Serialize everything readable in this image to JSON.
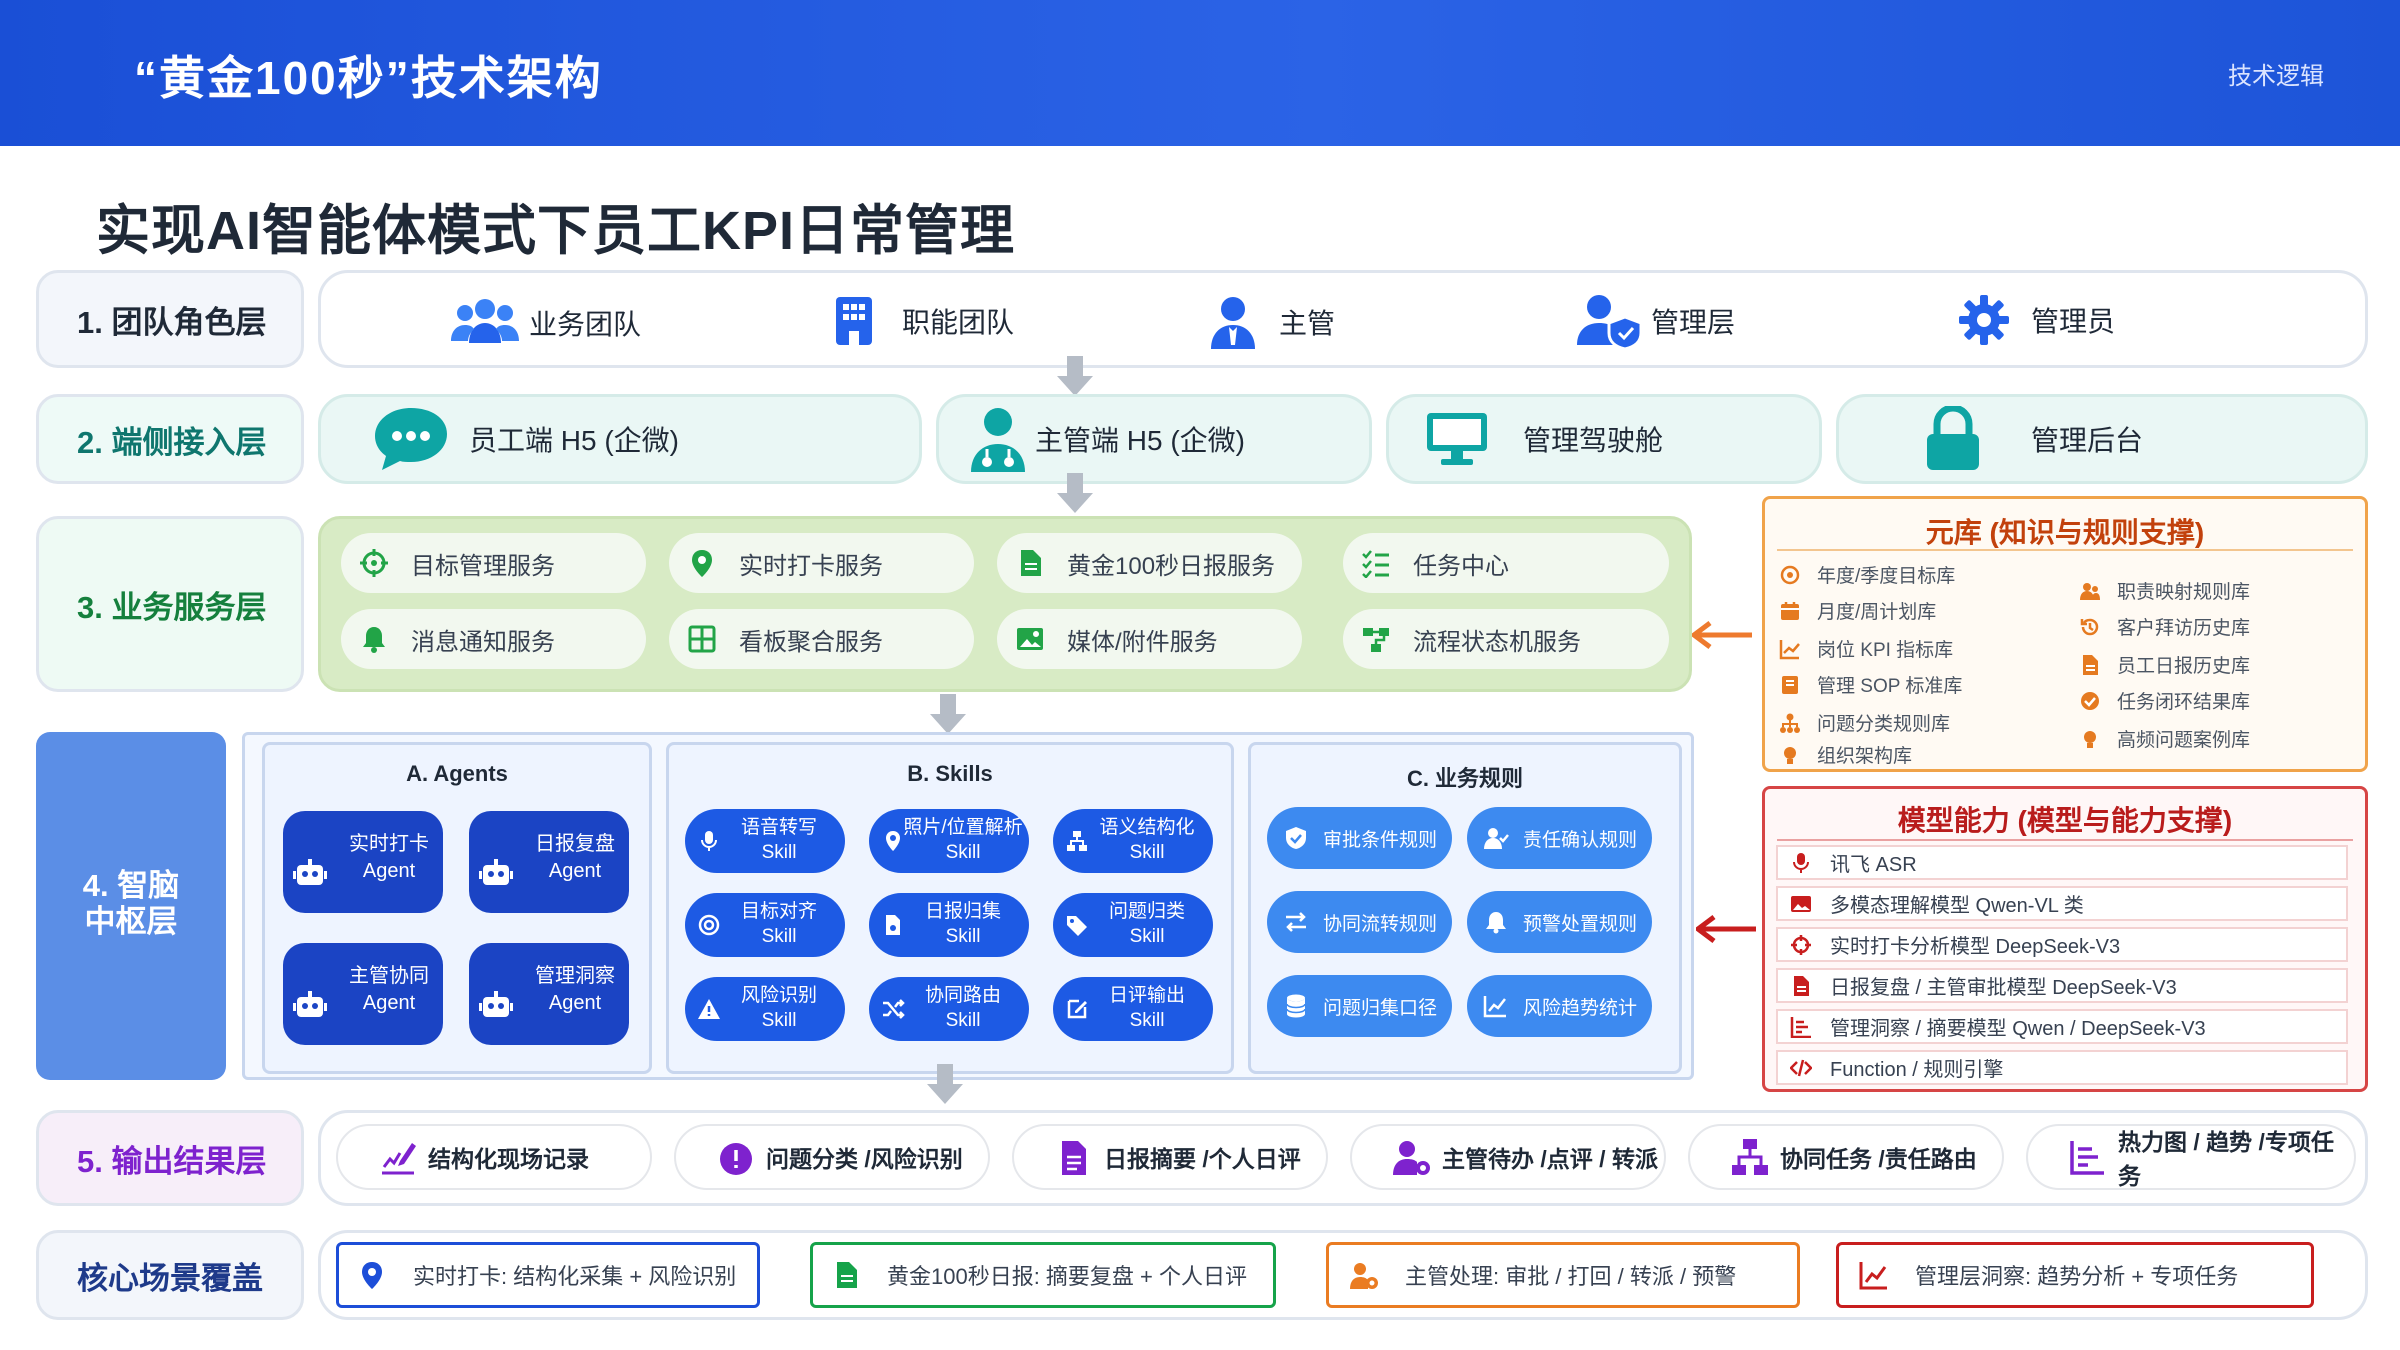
{
  "header": {
    "title": "“黄金100秒”技术架构",
    "tag": "技术逻辑"
  },
  "page_title": "实现AI智能体模式下员工KPI日常管理",
  "layer1": {
    "label": "1. 团队角色层",
    "roles": [
      {
        "label": "业务团队",
        "icon": "team-icon"
      },
      {
        "label": "职能团队",
        "icon": "building-icon"
      },
      {
        "label": "主管",
        "icon": "supervisor-icon"
      },
      {
        "label": "管理层",
        "icon": "manager-shield-icon"
      },
      {
        "label": "管理员",
        "icon": "gear-icon"
      }
    ]
  },
  "layer2": {
    "label": "2. 端侧接入层",
    "endpoints": [
      {
        "label": "员工端 H5 (企微)",
        "icon": "chat-icon"
      },
      {
        "label": "主管端 H5 (企微)",
        "icon": "doctor-icon"
      },
      {
        "label": "管理驾驶舱",
        "icon": "monitor-icon"
      },
      {
        "label": "管理后台",
        "icon": "lock-icon"
      }
    ]
  },
  "layer3": {
    "label": "3. 业务服务层",
    "services": [
      {
        "label": "目标管理服务",
        "icon": "target-icon"
      },
      {
        "label": "实时打卡服务",
        "icon": "location-icon"
      },
      {
        "label": "黄金100秒日报服务",
        "icon": "doc-icon"
      },
      {
        "label": "任务中心",
        "icon": "tasklist-icon"
      },
      {
        "label": "消息通知服务",
        "icon": "bell-icon"
      },
      {
        "label": "看板聚合服务",
        "icon": "grid-icon"
      },
      {
        "label": "媒体/附件服务",
        "icon": "image-icon"
      },
      {
        "label": "流程状态机服务",
        "icon": "flow-icon"
      }
    ]
  },
  "knowledge": {
    "title": "元库 (知识与规则支撑)",
    "left": [
      "年度/季度目标库",
      "月度/周计划库",
      "岗位 KPI 指标库",
      "管理 SOP 标准库",
      "问题分类规则库",
      "组织架构库"
    ],
    "right": [
      "职责映射规则库",
      "客户拜访历史库",
      "员工日报历史库",
      "任务闭环结果库",
      "高频问题案例库"
    ]
  },
  "models": {
    "title": "模型能力 (模型与能力支撑)",
    "items": [
      "讯飞 ASR",
      "多模态理解模型 Qwen-VL 类",
      "实时打卡分析模型 DeepSeek-V3",
      "日报复盘 / 主管审批模型 DeepSeek-V3",
      "管理洞察 / 摘要模型 Qwen / DeepSeek-V3",
      "Function / 规则引擎"
    ]
  },
  "layer4": {
    "label_line1": "4. 智脑",
    "label_line2": "中枢层",
    "agents": {
      "title": "A. Agents",
      "items": [
        {
          "line1": "实时打卡",
          "line2": "Agent"
        },
        {
          "line1": "日报复盘",
          "line2": "Agent"
        },
        {
          "line1": "主管协同",
          "line2": "Agent"
        },
        {
          "line1": "管理洞察",
          "line2": "Agent"
        }
      ]
    },
    "skills": {
      "title": "B. Skills",
      "items": [
        {
          "line1": "语音转写",
          "line2": "Skill"
        },
        {
          "line1": "照片/位置解析",
          "line2": "Skill"
        },
        {
          "line1": "语义结构化",
          "line2": "Skill"
        },
        {
          "line1": "目标对齐",
          "line2": "Skill"
        },
        {
          "line1": "日报归集",
          "line2": "Skill"
        },
        {
          "line1": "问题归类",
          "line2": "Skill"
        },
        {
          "line1": "风险识别",
          "line2": "Skill"
        },
        {
          "line1": "协同路由",
          "line2": "Skill"
        },
        {
          "line1": "日评输出",
          "line2": "Skill"
        }
      ]
    },
    "rules": {
      "title": "C. 业务规则",
      "items": [
        "审批条件规则",
        "责任确认规则",
        "协同流转规则",
        "预警处置规则",
        "问题归集口径",
        "风险趋势统计"
      ]
    }
  },
  "layer5": {
    "label": "5. 输出结果层",
    "outputs": [
      "结构化现场记录",
      "问题分类 /风险识别",
      "日报摘要 /个人日评",
      "主管待办 /点评 / 转派",
      "协同任务 /责任路由",
      "热力图 / 趋势 /专项任务"
    ]
  },
  "scenes": {
    "label": "核心场景覆盖",
    "items": [
      {
        "label": "实时打卡: 结构化采集 + 风险识别",
        "color": "#1d4ed8"
      },
      {
        "label": "黄金100秒日报: 摘要复盘 + 个人日评",
        "color": "#16a34a"
      },
      {
        "label": "主管处理: 审批 / 打回 / 转派 / 预警",
        "color": "#ea7c22"
      },
      {
        "label": "管理层洞察: 趋势分析 + 专项任务",
        "color": "#c81e1e"
      }
    ]
  },
  "colors": {
    "primary": "#1d4ed8",
    "knowledge_border": "#f0a34a",
    "model_border": "#d64545",
    "service_bg": "#d9ecc6"
  }
}
